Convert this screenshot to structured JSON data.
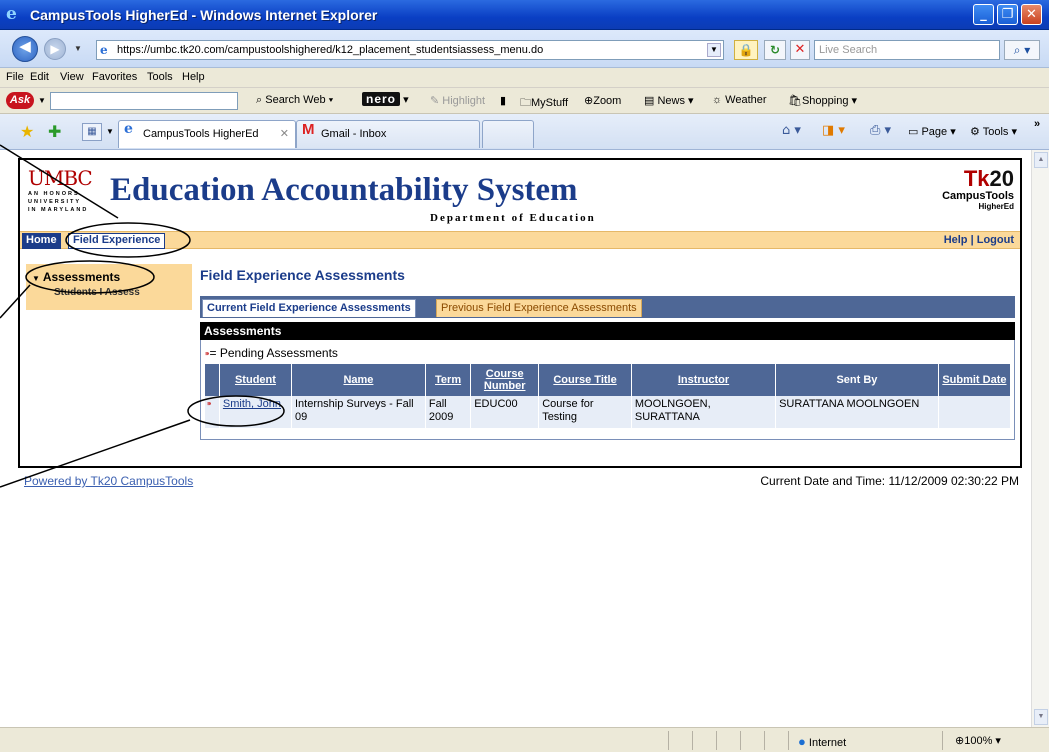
{
  "window": {
    "title": "CampusTools HigherEd - Windows Internet Explorer"
  },
  "address": {
    "url": "https://umbc.tk20.com/campustoolshighered/k12_placement_studentsiassess_menu.do",
    "search_placeholder": "Live Search"
  },
  "menu": [
    "File",
    "Edit",
    "View",
    "Favorites",
    "Tools",
    "Help"
  ],
  "ask_toolbar": {
    "logo": "Ask",
    "search_web": "Search Web",
    "nero": "nero",
    "highlight": "Highlight",
    "mystuff": "MyStuff",
    "zoom": "Zoom",
    "news": "News",
    "weather": "Weather",
    "shopping": "Shopping"
  },
  "tabs": [
    {
      "label": "CampusTools HigherEd"
    },
    {
      "label": "Gmail - Inbox"
    }
  ],
  "commandbar": {
    "page": "Page",
    "tools": "Tools"
  },
  "site": {
    "logo_main": "UMBC",
    "logo_sub1": "AN HONORS",
    "logo_sub2": "UNIVERSITY",
    "logo_sub3": "IN MARYLAND",
    "system_name": "Education Accountability System",
    "department": "Department of Education",
    "brand_tk": "Tk",
    "brand_20": "20",
    "brand_line1": "CampusTools",
    "brand_line2": "HigherEd"
  },
  "nav": {
    "home": "Home",
    "field_experience": "Field Experience",
    "help": "Help",
    "sep": "|",
    "logout": "Logout"
  },
  "leftnav": {
    "heading": "Assessments",
    "item": "Students I Assess"
  },
  "main": {
    "title": "Field Experience Assessments",
    "tab_current": "Current Field Experience Assessments",
    "tab_previous": "Previous Field Experience Assessments",
    "section": "Assessments",
    "pending_legend": "= Pending Assessments",
    "columns": [
      "Student",
      "Name",
      "Term",
      "Course Number",
      "Course Title",
      "Instructor",
      "Sent By",
      "Submit Date"
    ],
    "rows": [
      {
        "student": "Smith, John",
        "name": "Internship Surveys - Fall 09",
        "term": "Fall 2009",
        "course_number": "EDUC00",
        "course_title": "Course for Testing",
        "instructor": "MOOLNGOEN, SURATTANA",
        "sent_by": "SURATTANA MOOLNGOEN",
        "submit_date": ""
      }
    ]
  },
  "footer": {
    "powered": "Powered by Tk20 CampusTools",
    "datetime": "Current Date and Time: 11/12/2009 02:30:22 PM"
  },
  "status": {
    "zone": "Internet",
    "zoom": "100%"
  },
  "colors": {
    "brand_blue": "#1b3c8a",
    "nav_orange": "#fbd99a",
    "header_red": "#b00000",
    "table_header": "#4e6796"
  }
}
